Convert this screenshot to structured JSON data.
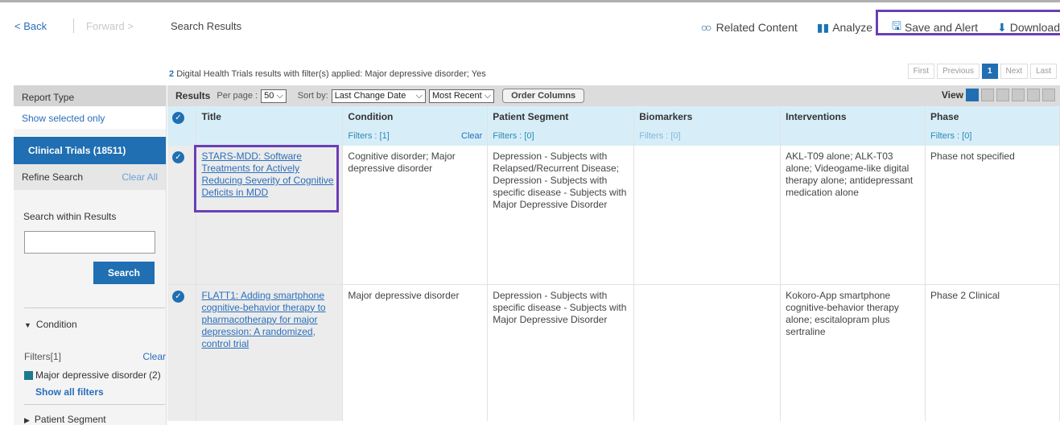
{
  "nav": {
    "back": "< Back",
    "forward": "Forward >",
    "crumb": "Search Results"
  },
  "tools": {
    "related": "Related Content",
    "analyze": "Analyze",
    "save": "Save and Alert",
    "download": "Download"
  },
  "summary": {
    "count": "2",
    "text": "Digital Health Trials results with filter(s) applied:  Major depressive disorder; Yes"
  },
  "pager": {
    "first": "First",
    "previous": "Previous",
    "current": "1",
    "next": "Next",
    "last": "Last"
  },
  "sidebar": {
    "report_type": "Report Type",
    "show_selected": "Show selected only",
    "clinical_trials": "Clinical Trials (18511)",
    "refine": "Refine Search",
    "clear_all": "Clear All",
    "search_within": "Search within Results",
    "search_btn": "Search",
    "condition": "Condition",
    "filters": "Filters[1]",
    "clear": "Clear",
    "mdd": "Major depressive disorder",
    "mdd_count": "(2)",
    "show_all": "Show all filters",
    "patient_segment": "Patient Segment"
  },
  "toolbar": {
    "results": "Results",
    "per_page_label": "Per page :",
    "per_page": "50",
    "sort_label": "Sort by:",
    "sort": "Last Change Date",
    "order": "Most Recent",
    "order_columns": "Order Columns",
    "view": "View"
  },
  "columns": {
    "title": "Title",
    "condition": "Condition",
    "patient": "Patient Segment",
    "biomarkers": "Biomarkers",
    "interventions": "Interventions",
    "phase": "Phase"
  },
  "filters": {
    "condition": "Filters : [1]",
    "condition_clear": "Clear",
    "patient": "Filters : [0]",
    "biomarkers": "Filters : [0]",
    "phase": "Filters : [0]"
  },
  "rows": [
    {
      "title": "STARS-MDD: Software Treatments for Actively Reducing Severity of Cognitive Deficits in MDD",
      "condition": "Cognitive disorder; Major depressive disorder",
      "patient": "Depression - Subjects with Relapsed/Recurrent Disease; Depression - Subjects with specific disease - Subjects with Major Depressive Disorder",
      "biomarkers": "",
      "interventions": "AKL-T09 alone; ALK-T03 alone; Videogame-like digital therapy alone; antidepressant medication alone",
      "phase": "Phase not specified"
    },
    {
      "title": "FLATT1: Adding smartphone cognitive-behavior therapy to pharmacotherapy for major depression: A randomized, control trial",
      "condition": "Major depressive disorder",
      "patient": "Depression - Subjects with specific disease - Subjects with Major Depressive Disorder",
      "biomarkers": "",
      "interventions": "Kokoro-App smartphone cognitive-behavior therapy alone; escitalopram plus sertraline",
      "phase": "Phase 2 Clinical"
    }
  ]
}
